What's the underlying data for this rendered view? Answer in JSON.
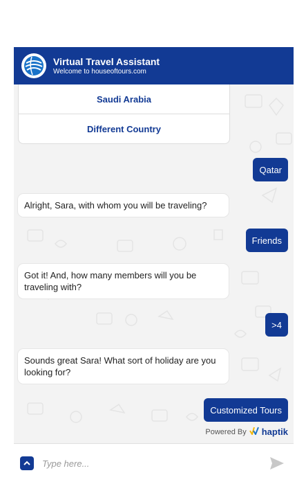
{
  "header": {
    "title": "Virtual Travel Assistant",
    "subtitle": "Welcome to houseoftours.com",
    "logo_icon": "globe-icon"
  },
  "quick_replies": [
    {
      "label": "Saudi Arabia"
    },
    {
      "label": "Different Country"
    }
  ],
  "messages": [
    {
      "sender": "user",
      "text": "Qatar"
    },
    {
      "sender": "bot",
      "text": "Alright, Sara, with whom you will be traveling?"
    },
    {
      "sender": "user",
      "text": "Friends"
    },
    {
      "sender": "bot",
      "text": "Got it! And, how many members will you be traveling with?"
    },
    {
      "sender": "user",
      "text": ">4"
    },
    {
      "sender": "bot",
      "text": "Sounds great Sara! What sort of holiday are you looking for?"
    },
    {
      "sender": "user",
      "text": "Customized Tours"
    }
  ],
  "footer": {
    "powered_label": "Powered By",
    "brand": "haptik"
  },
  "input": {
    "placeholder": "Type here..."
  },
  "colors": {
    "primary": "#123a94",
    "chat_background": "#f3f3f3",
    "bubble_bot": "#ffffff"
  }
}
